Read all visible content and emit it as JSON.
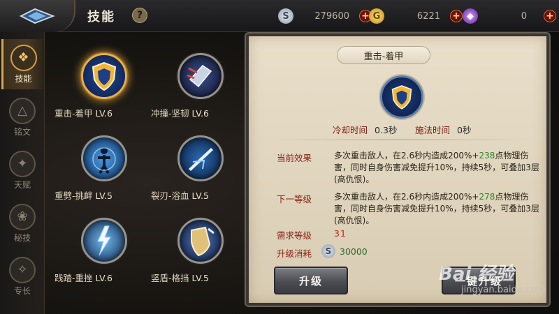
{
  "header": {
    "title": "技能",
    "help_label": "?",
    "currencies": [
      {
        "name": "silver",
        "amount": "279600",
        "glyph": "S",
        "color": "#b7c2ce"
      },
      {
        "name": "gold",
        "amount": "6221",
        "glyph": "G",
        "color": "#e8b321"
      },
      {
        "name": "gem",
        "amount": "0",
        "glyph": "◆",
        "color": "#9a4bd6"
      }
    ],
    "plus_label": "+"
  },
  "sidebar": {
    "items": [
      {
        "label": "技能",
        "icon": "book-icon",
        "glyph": "❖",
        "active": true
      },
      {
        "label": "铭文",
        "icon": "triangle-rune-icon",
        "glyph": "△",
        "active": false
      },
      {
        "label": "天赋",
        "icon": "wings-icon",
        "glyph": "✦",
        "active": false
      },
      {
        "label": "秘技",
        "icon": "lotus-icon",
        "glyph": "❀",
        "active": false
      },
      {
        "label": "专长",
        "icon": "crest-icon",
        "glyph": "✧",
        "active": false
      }
    ]
  },
  "skills": [
    {
      "name": "重击-着甲",
      "level": "LV.6",
      "icon": "shield-icon",
      "selected": true
    },
    {
      "name": "冲撞-坚韧",
      "level": "LV.6",
      "icon": "charge-icon",
      "selected": false
    },
    {
      "name": "重劈-挑衅",
      "level": "LV.5",
      "icon": "warrior-icon",
      "selected": false
    },
    {
      "name": "裂刃-浴血",
      "level": "LV.5",
      "icon": "blade-icon",
      "selected": false
    },
    {
      "name": "践踏-重挫",
      "level": "LV.6",
      "icon": "lightning-icon",
      "selected": false
    },
    {
      "name": "竖盾-格挡",
      "level": "LV.5",
      "icon": "raised-shield-icon",
      "selected": false
    }
  ],
  "detail": {
    "title": "重击-着甲",
    "cooldown_label": "冷却时间",
    "cooldown_value": "0.3秒",
    "cast_label": "施法时间",
    "cast_value": "0秒",
    "current_label": "当前效果",
    "current_text_a": "多次重击敌人，在2.6秒内造成200%+",
    "current_value": "238",
    "current_text_b": "点物理伤害，同时自身伤害减免提升10%，持续5秒，可叠加3层(高仇恨)。",
    "next_label": "下一等级",
    "next_text_a": "多次重击敌人，在2.6秒内造成200%+",
    "next_value": "278",
    "next_text_b": "点物理伤害，同时自身伤害减免提升10%，持续5秒，可叠加3层(高仇恨)。",
    "req_label": "需求等级",
    "req_value": "31",
    "cost_label": "升级消耗",
    "cost_value": "30000",
    "upgrade_button": "升级",
    "oneclick_button": "一键升级"
  },
  "watermark": {
    "logo": "Bai 经验",
    "url": "jingyan.baidu.com"
  }
}
